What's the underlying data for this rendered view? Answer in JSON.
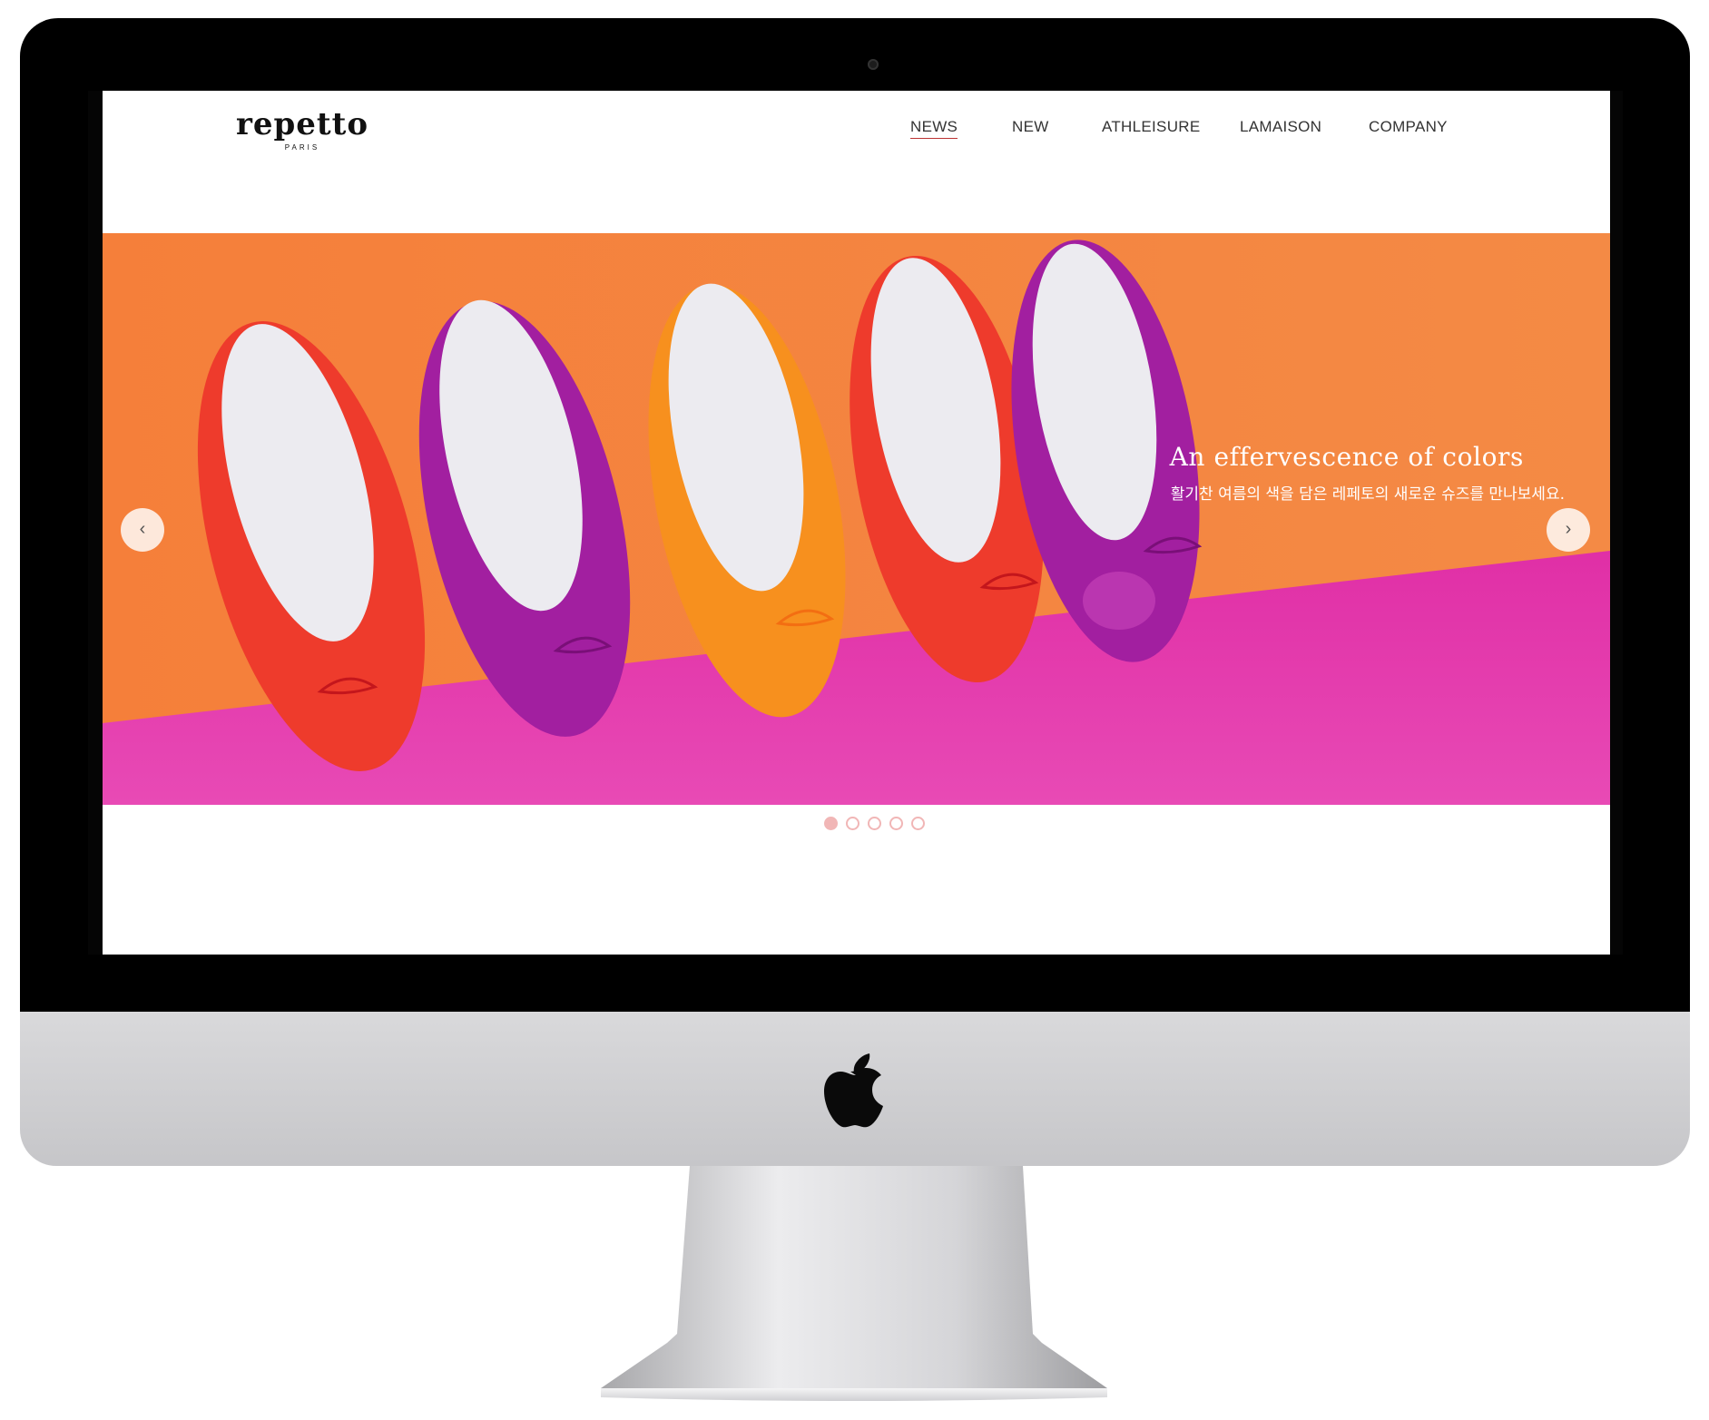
{
  "header": {
    "logo_text": "repetto",
    "logo_sub": "PARIS",
    "nav": [
      "NEWS",
      "NEW",
      "ATHLEISURE",
      "LAMAISON",
      "COMPANY"
    ],
    "active_nav": "NEWS"
  },
  "hero": {
    "title": "An effervescence of colors",
    "subtitle": "활기찬 여름의 색을 담은 레페토의 새로운 슈즈를 만나보세요.",
    "prev_icon": "‹",
    "next_icon": "›",
    "slide_count": 5,
    "active_slide": 1
  },
  "colors": {
    "orange_wall": "#f4823c",
    "magenta_floor": "#e035a8",
    "shoe_red": "#ee3b2c",
    "shoe_purple": "#a21fa0",
    "shoe_orange": "#f7901e",
    "dot": "#f1b6b6"
  },
  "icons": {
    "prev": "chevron-left-icon",
    "next": "chevron-right-icon",
    "device_logo": "apple-logo-icon"
  }
}
